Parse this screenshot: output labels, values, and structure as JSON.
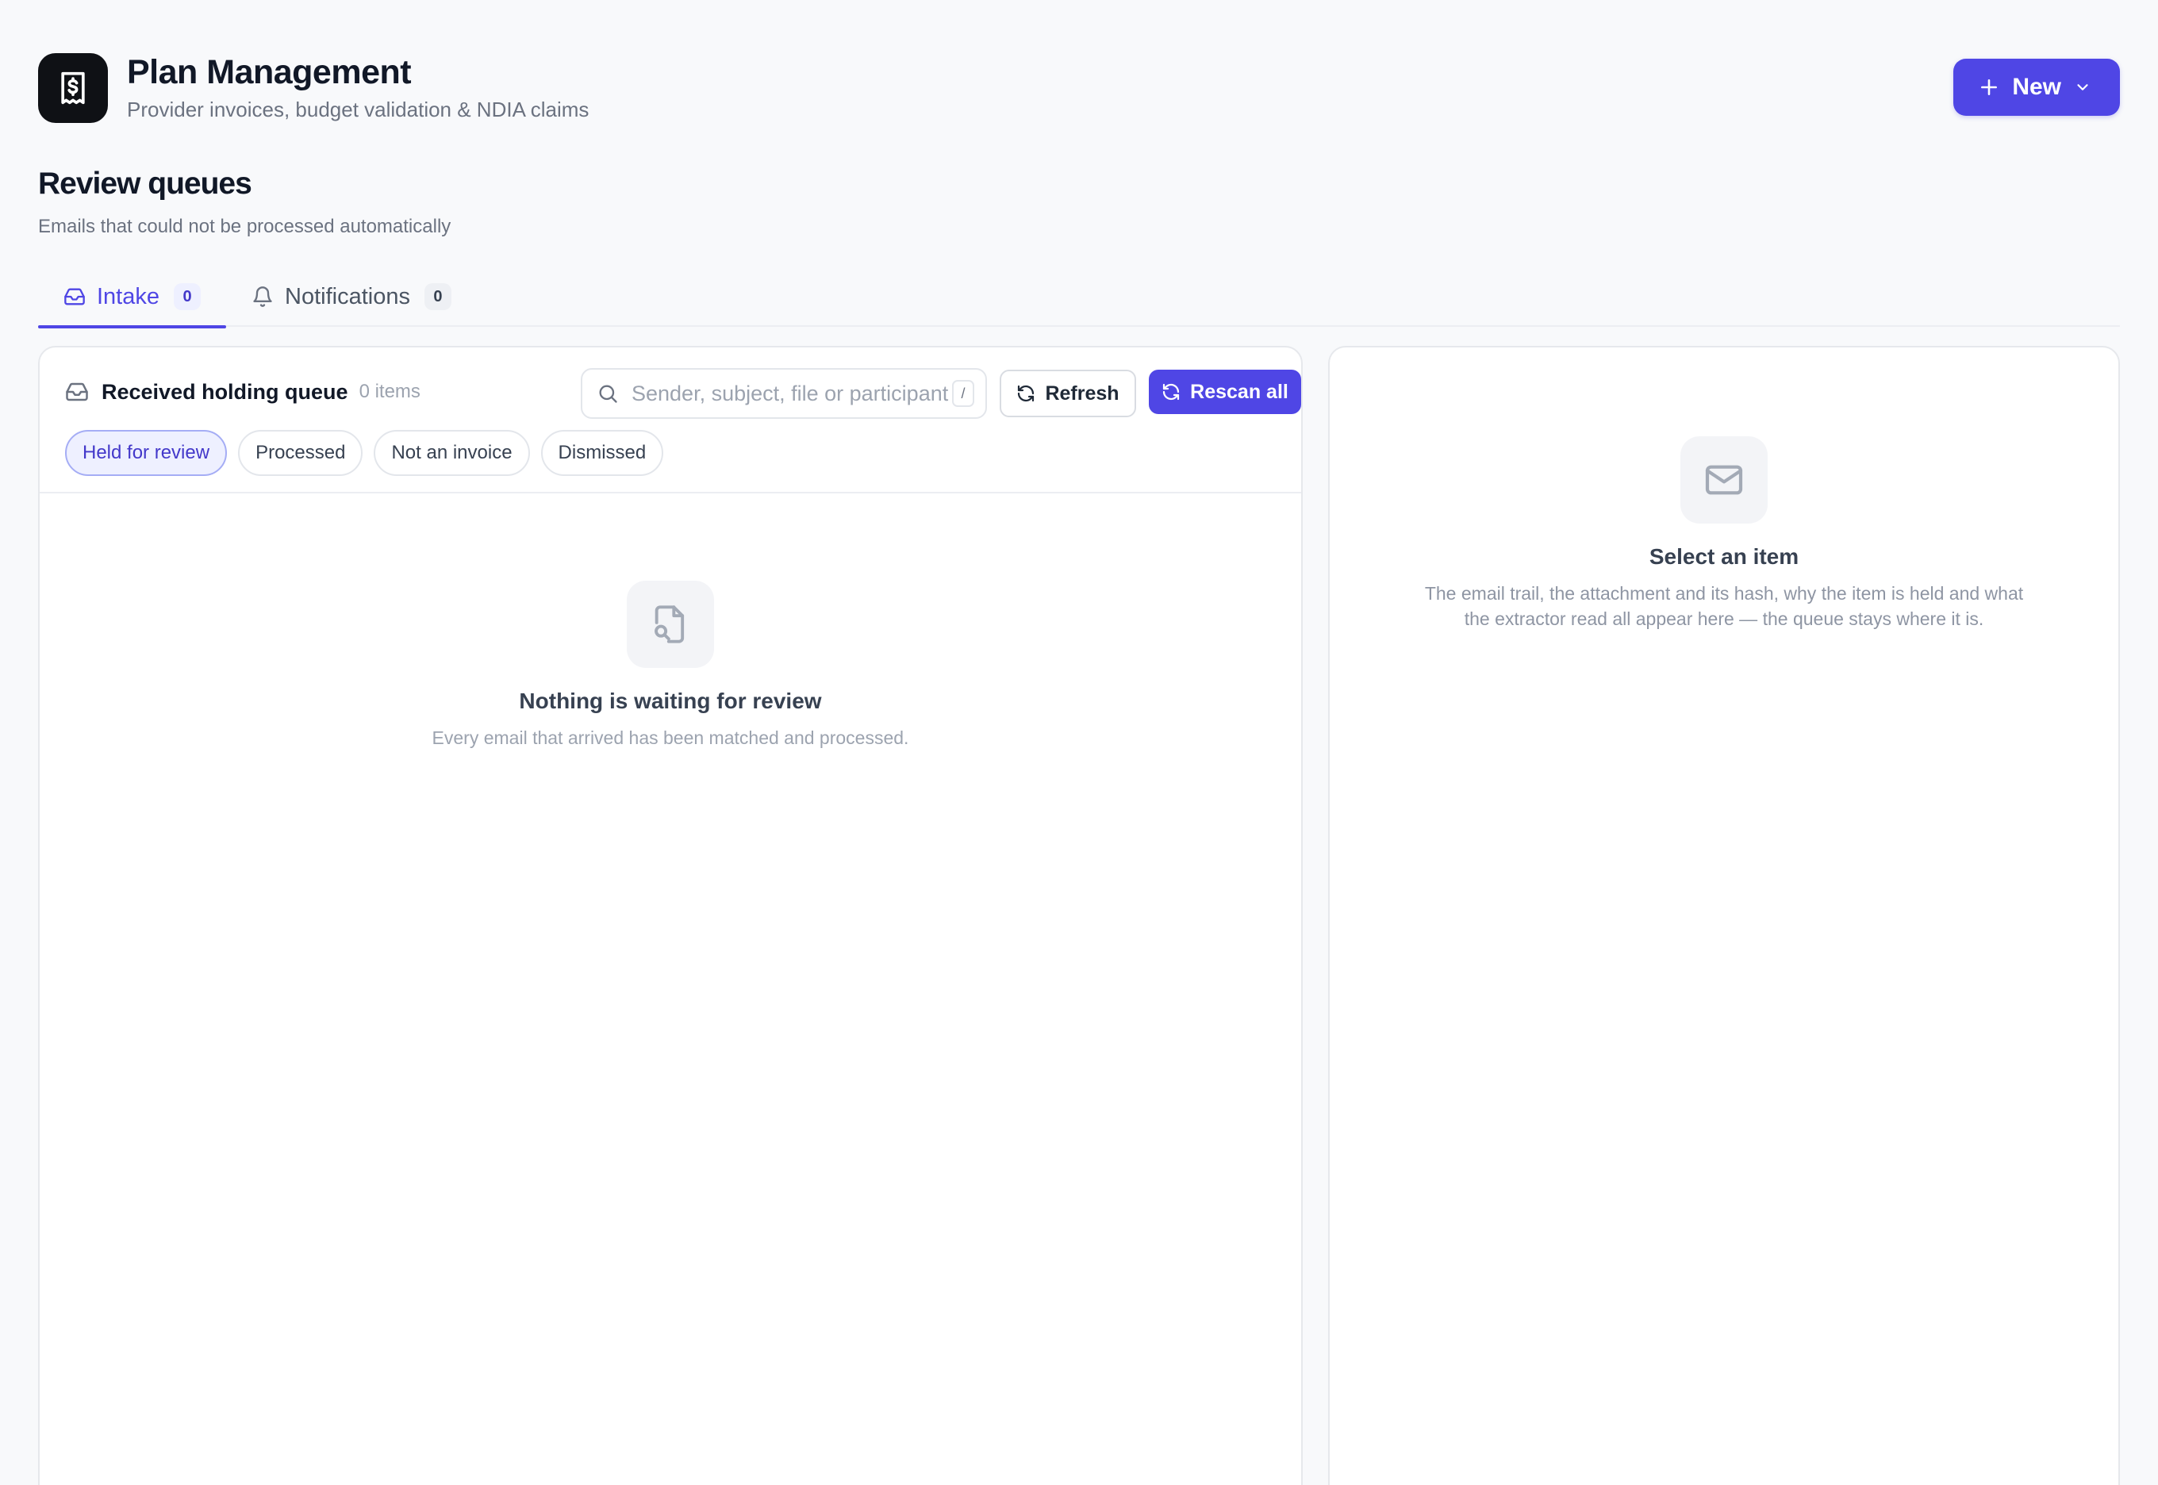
{
  "app": {
    "title": "Plan Management",
    "subtitle": "Provider invoices, budget validation & NDIA claims",
    "new_button_label": "New",
    "logo_icon": "receipt-dollar-icon"
  },
  "section": {
    "title": "Review queues",
    "subtitle": "Emails that could not be processed automatically"
  },
  "tabs": [
    {
      "label": "Intake",
      "count": "0",
      "icon": "inbox-icon",
      "active": true
    },
    {
      "label": "Notifications",
      "count": "0",
      "icon": "bell-icon",
      "active": false
    }
  ],
  "queue": {
    "title": "Received holding queue",
    "count_text": "0 items",
    "search": {
      "placeholder": "Sender, subject, file or participant",
      "value": "",
      "shortcut": "/"
    },
    "refresh_label": "Refresh",
    "rescan_label": "Rescan all",
    "filters": [
      {
        "label": "Held for review",
        "active": true
      },
      {
        "label": "Processed",
        "active": false
      },
      {
        "label": "Not an invoice",
        "active": false
      },
      {
        "label": "Dismissed",
        "active": false
      }
    ],
    "empty": {
      "title": "Nothing is waiting for review",
      "text": "Every email that arrived has been matched and processed."
    }
  },
  "detail": {
    "empty": {
      "title": "Select an item",
      "text": "The email trail, the attachment and its hash, why the item is held and what the extractor read all appear here — the queue stays where it is."
    }
  },
  "colors": {
    "accent": "#4f46e5",
    "background": "#f8f9fb",
    "logo_bg": "#0f1115"
  }
}
